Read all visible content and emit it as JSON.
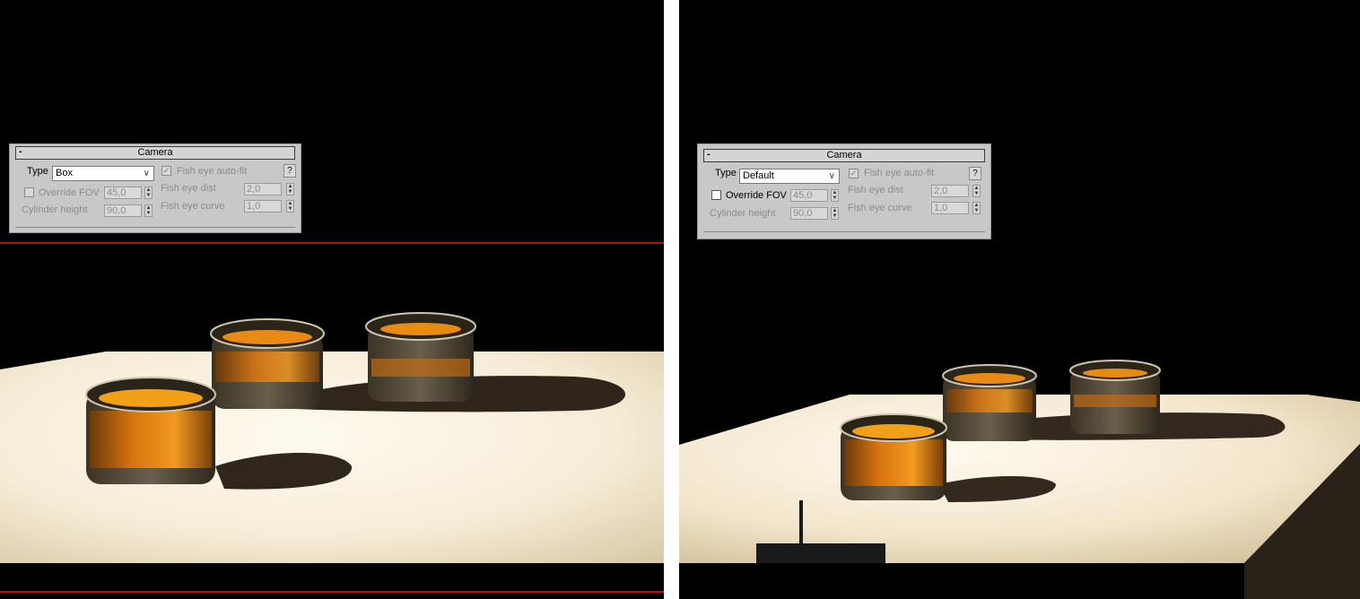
{
  "panels": [
    {
      "title": "Camera",
      "collapse_symbol": "-",
      "type_label": "Type",
      "type_value": "Box",
      "override_fov_label": "Override FOV",
      "override_fov_value": "45,0",
      "cylinder_height_label": "Cylinder height",
      "cylinder_height_value": "90,0",
      "fish_eye_autofit_label": "Fish eye auto-fit",
      "fish_eye_dist_label": "Fish eye dist",
      "fish_eye_dist_value": "2,0",
      "fish_eye_curve_label": "Fish eye curve",
      "fish_eye_curve_value": "1,0",
      "help_label": "?"
    },
    {
      "title": "Camera",
      "collapse_symbol": "-",
      "type_label": "Type",
      "type_value": "Default",
      "override_fov_label": "Override FOV",
      "override_fov_value": "45,0",
      "cylinder_height_label": "Cylinder height",
      "cylinder_height_value": "90,0",
      "fish_eye_autofit_label": "Fish eye auto-fit",
      "fish_eye_dist_label": "Fish eye dist",
      "fish_eye_dist_value": "2,0",
      "fish_eye_curve_label": "Fish eye curve",
      "fish_eye_curve_value": "1,0",
      "help_label": "?"
    }
  ],
  "colors": {
    "viewport_background": "#000000",
    "floor": "#f3e9d4",
    "liquid": "#e98a14",
    "glass": "#5a5040",
    "region_border": "#b01010"
  }
}
